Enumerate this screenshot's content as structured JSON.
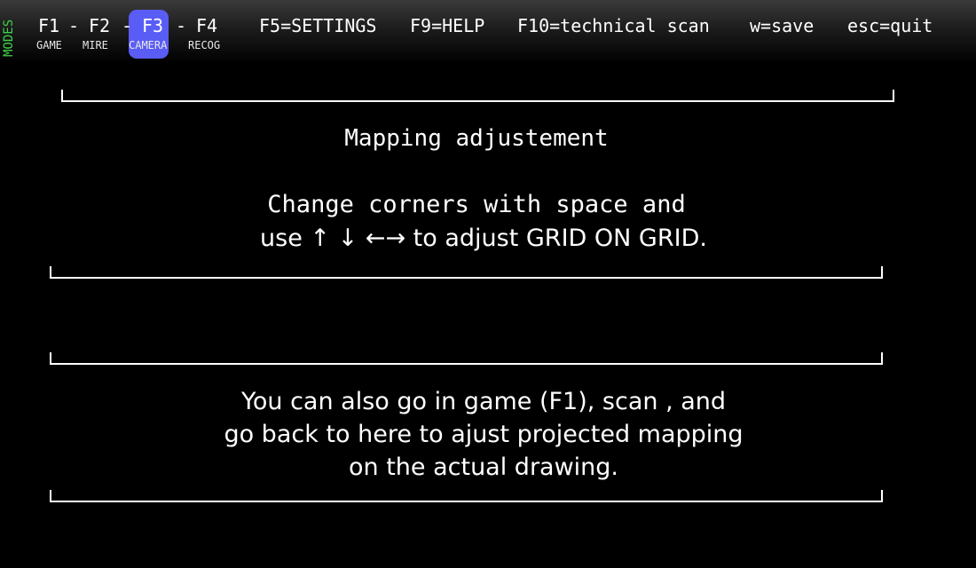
{
  "topbar": {
    "modes_label": "MODES",
    "modes": [
      {
        "key": "F1",
        "label": "GAME"
      },
      {
        "key": "F2",
        "label": "MIRE"
      },
      {
        "key": "F3",
        "label": "CAMERA",
        "active": true
      },
      {
        "key": "F4",
        "label": "RECOG"
      }
    ],
    "separator": "-",
    "commands": {
      "settings": "F5=SETTINGS",
      "help": "F9=HELP",
      "scan": "F10=technical scan",
      "save": "w=save",
      "quit": "esc=quit"
    }
  },
  "colors": {
    "modes_label": "#3fd24a",
    "active_mode": "#5a5cf6",
    "background": "#000000",
    "text": "#ffffff"
  },
  "panel": {
    "title": "Mapping adjustement",
    "instruction_line1": "Change corners with space and",
    "instruction_line2": "use ↑ ↓ ←→ to adjust GRID ON GRID.",
    "info_line1": "You can also go in game (F1), scan , and",
    "info_line2": "go back to here to ajust projected mapping",
    "info_line3": "on the actual drawing."
  }
}
